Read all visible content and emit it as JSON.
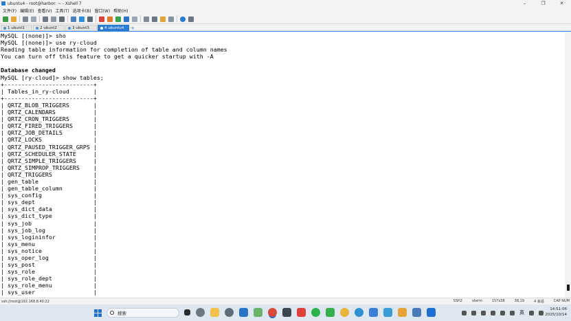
{
  "window": {
    "title": "ubuntu4 - root@harbor: ~ - Xshell 7"
  },
  "menu": [
    "文件(F)",
    "编辑(E)",
    "查看(V)",
    "工具(T)",
    "选项卡(B)",
    "窗口(W)",
    "帮助(H)"
  ],
  "tabs": [
    {
      "label": "1 ubunt1",
      "active": false
    },
    {
      "label": "2 ubunt2",
      "active": false
    },
    {
      "label": "3 ubunt3",
      "active": false
    },
    {
      "label": "4 ubuntu4",
      "active": true
    }
  ],
  "terminal": {
    "lines": [
      "MySQL [(none)]> sho",
      "MySQL [(none)]> use ry-cloud",
      "Reading table information for completion of table and column names",
      "You can turn off this feature to get a quicker startup with -A",
      "",
      "Database changed",
      "MySQL [ry-cloud]> show tables;",
      "+--------------------------+",
      "| Tables_in_ry-cloud       |",
      "+--------------------------+",
      "| QRTZ_BLOB_TRIGGERS       |",
      "| QRTZ_CALENDARS           |",
      "| QRTZ_CRON_TRIGGERS       |",
      "| QRTZ_FIRED_TRIGGERS      |",
      "| QRTZ_JOB_DETAILS         |",
      "| QRTZ_LOCKS               |",
      "| QRTZ_PAUSED_TRIGGER_GRPS |",
      "| QRTZ_SCHEDULER_STATE     |",
      "| QRTZ_SIMPLE_TRIGGERS     |",
      "| QRTZ_SIMPROP_TRIGGERS    |",
      "| QRTZ_TRIGGERS            |",
      "| gen_table                |",
      "| gen_table_column         |",
      "| sys_config               |",
      "| sys_dept                 |",
      "| sys_dict_data            |",
      "| sys_dict_type            |",
      "| sys_job                  |",
      "| sys_job_log              |",
      "| sys_logininfor           |",
      "| sys_menu                 |",
      "| sys_notice               |",
      "| sys_oper_log             |",
      "| sys_post                 |",
      "| sys_role                 |",
      "| sys_role_dept            |",
      "| sys_role_menu            |",
      "| sys_user                 |"
    ]
  },
  "statusbar": {
    "connection": "ssh://root@192.168.8.40:22",
    "protocol": "SSH2",
    "term": "xterm",
    "size": "157x38",
    "cursor": "38,19",
    "sessions": "4 会话",
    "caps": "CAP NUM"
  },
  "taskbar": {
    "search_placeholder": "搜索",
    "ime": "英",
    "time": "14:51:06",
    "date": "2025/10/14"
  },
  "colors": {
    "accent": "#2a7bd4",
    "taskbar": "#dfe8f1"
  }
}
